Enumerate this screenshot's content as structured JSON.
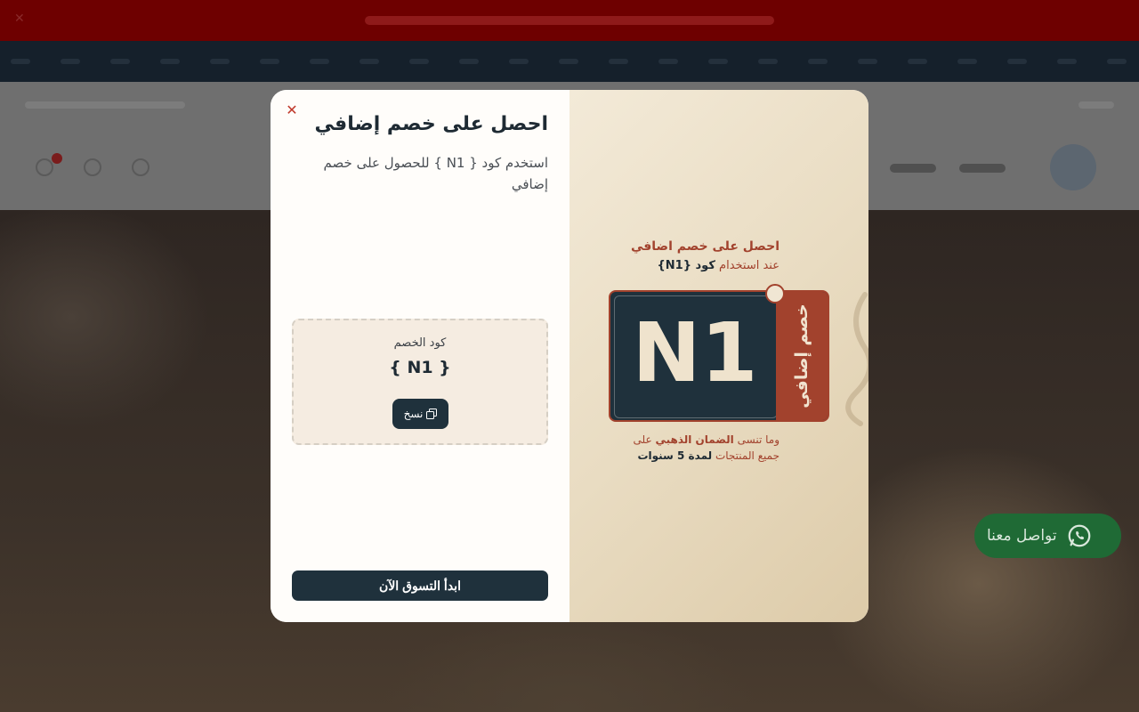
{
  "colors": {
    "primary_dark": "#1f313c",
    "accent_brown": "#a2422d",
    "close_red": "#c0392b",
    "whatsapp_green": "#1f6a35",
    "announcement_red": "#6e0000"
  },
  "modal": {
    "title": "احصل على خصم إضافي",
    "description": "استخدم كود { N1 } للحصول على خصم إضافي",
    "close_icon": "close-icon",
    "code_box": {
      "label": "كود الخصم",
      "code": "{ N1 }",
      "copy_button": "نسخ",
      "copy_icon": "copy-icon"
    },
    "cta_button": "ابدأ التسوق الآن"
  },
  "promo": {
    "headline": "احصل على خصم اضافي",
    "subline_prefix": "عند استخدام",
    "subline_code": "كود {N1}",
    "coupon_code": "N1",
    "coupon_side": "خصم إضافي",
    "footer_line1_prefix": "وما تنسى",
    "footer_line1_highlight": "الضمان الذهبي",
    "footer_line1_suffix": "على",
    "footer_line2_prefix": "جميع المنتجات",
    "footer_line2_highlight": "لمدة 5 سنوات"
  },
  "whatsapp": {
    "label": "تواصل معنا",
    "icon": "whatsapp-icon"
  }
}
